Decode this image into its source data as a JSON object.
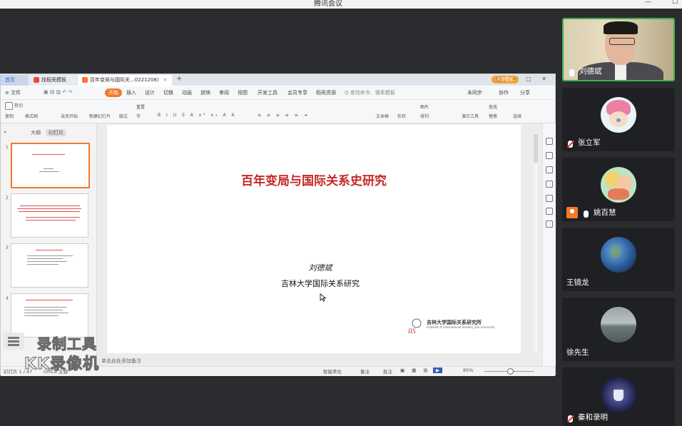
{
  "meeting": {
    "title": "腾讯会议"
  },
  "wps": {
    "tabs": [
      {
        "label": "首页"
      },
      {
        "label": "找稻壳模板"
      },
      {
        "label": "百年变局与国际关...0221208)"
      }
    ],
    "login_label": "立即登录",
    "menu": [
      "≡ 文件",
      "开始",
      "插入",
      "设计",
      "切换",
      "动画",
      "放映",
      "审阅",
      "视图",
      "开发工具",
      "会员专享",
      "稻壳资源",
      "Q 查找命令、搜索模板"
    ],
    "menu_right": [
      "未同步",
      "协作",
      "分享"
    ],
    "toolbar": [
      "剪切",
      "复制",
      "格式刷",
      "当页开始",
      "新建幻灯片",
      "版式",
      "节",
      "重置",
      "文本框",
      "形状",
      "图片",
      "排列",
      "演示工具",
      "查找",
      "替换",
      "选择"
    ],
    "panel_tabs": [
      "大纲",
      "幻灯片"
    ],
    "thumb_numbers": [
      "1",
      "2",
      "3",
      "4"
    ],
    "notes_placeholder": "单击此处添加备注",
    "status": {
      "slide_info": "幻灯片 1 / 47",
      "theme": "Office 主题",
      "smart_beautify": "智能美化",
      "notes": "备注",
      "comment": "批注",
      "zoom": "85%"
    }
  },
  "slide": {
    "title": "百年变局与国际关系史研究",
    "author": "刘德斌",
    "institution": "吉林大学国际关系研究",
    "logo_name": "吉林大学国际关系研究所",
    "logo_sub": "Institute of International Studies, Jilin University",
    "logo_mark": "IIS"
  },
  "participants": [
    {
      "name": "刘德斌",
      "mic": "on",
      "kind": "video",
      "speaking": true
    },
    {
      "name": "张立军",
      "mic": "muted",
      "kind": "avatar",
      "avatar": "cartoon-character-icon"
    },
    {
      "name": "姚百慧",
      "mic": "on",
      "kind": "avatar",
      "avatar": "cartoon-kids-icon"
    },
    {
      "name": "王镜龙",
      "mic": "none",
      "kind": "avatar",
      "avatar": "earth-globe-icon"
    },
    {
      "name": "徐先生",
      "mic": "none",
      "kind": "avatar",
      "avatar": "sea-landscape-icon"
    },
    {
      "name": "秦和录明",
      "mic": "muted",
      "kind": "avatar",
      "avatar": "space-cup-icon"
    }
  ],
  "watermark": {
    "line1": "录制工具",
    "line2": "KK录像机"
  },
  "colors": {
    "accent": "#f07a2a",
    "slide_title": "#c72828",
    "speaking": "#3bb34a"
  }
}
